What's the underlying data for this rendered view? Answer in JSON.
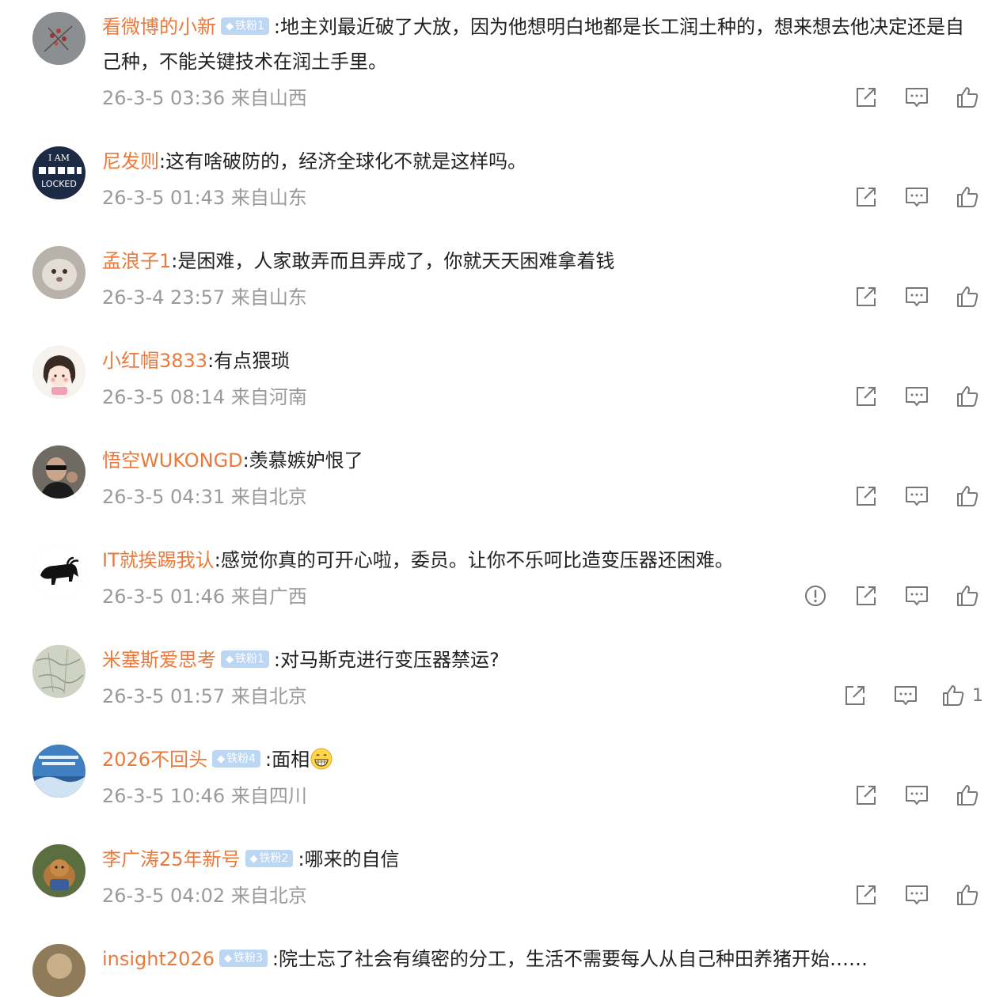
{
  "comments": [
    {
      "user": "看微博的小新",
      "badge": "铁粉1",
      "text": "地主刘最近破了大放，因为他想明白地都是长工润土种的，想来想去他决定还是自己种，不能关键技术在润土手里。",
      "time": "26-3-5 03:36",
      "location": "来自山西"
    },
    {
      "user": "尼发则",
      "badge": "",
      "text": "这有啥破防的，经济全球化不就是这样吗。",
      "time": "26-3-5 01:43",
      "location": "来自山东",
      "avatar_text": [
        "I AM",
        "LOCKED"
      ]
    },
    {
      "user": "孟浪子1",
      "badge": "",
      "text": "是困难，人家敢弄而且弄成了，你就天天困难拿着钱",
      "time": "26-3-4 23:57",
      "location": "来自山东"
    },
    {
      "user": "小红帽3833",
      "badge": "",
      "text": "有点猥琐",
      "time": "26-3-5 08:14",
      "location": "来自河南"
    },
    {
      "user": "悟空WUKONGD",
      "badge": "",
      "text": "羡慕嫉妒恨了",
      "time": "26-3-5 04:31",
      "location": "来自北京"
    },
    {
      "user": "IT就挨踢我认",
      "badge": "",
      "text": "感觉你真的可开心啦，委员。让你不乐呵比造变压器还困难。",
      "time": "26-3-5 01:46",
      "location": "来自广西"
    },
    {
      "user": "米塞斯爱思考",
      "badge": "铁粉1",
      "text": "对马斯克进行变压器禁运?",
      "time": "26-3-5 01:57",
      "location": "来自北京",
      "like_count": "1"
    },
    {
      "user": "2026不回头",
      "badge": "铁粉4",
      "text": "面相",
      "time": "26-3-5 10:46",
      "location": "来自四川",
      "emoji": "grin-emoji"
    },
    {
      "user": "李广涛25年新号",
      "badge": "铁粉2",
      "text": "哪来的自信",
      "time": "26-3-5 04:02",
      "location": "来自北京"
    },
    {
      "user": "insight2026",
      "badge": "铁粉3",
      "text": "院士忘了社会有缜密的分工，生活不需要每人从自己种田养猪开始……",
      "time": "",
      "location": ""
    }
  ],
  "icons": {
    "share": "share-icon",
    "comment": "comment-icon",
    "like": "thumbs-up-icon",
    "report": "report-icon"
  },
  "colors": {
    "username": "#ea7a3c",
    "meta": "#9a9a9a",
    "badge_bg": "#bcd7f3",
    "icon": "#777777"
  }
}
